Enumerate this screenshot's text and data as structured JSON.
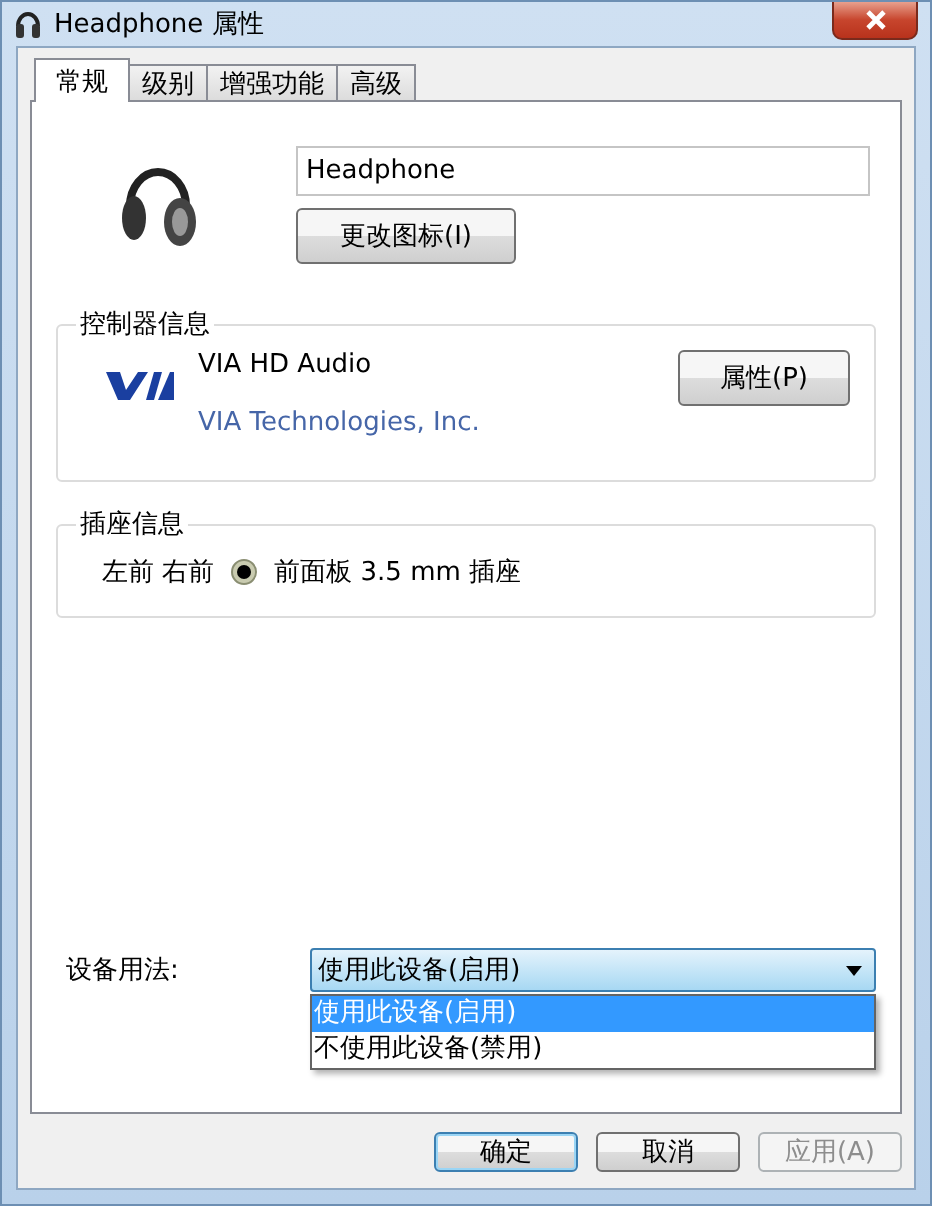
{
  "window": {
    "title": "Headphone 属性"
  },
  "tabs": [
    {
      "label": "常规",
      "selected": true
    },
    {
      "label": "级别",
      "selected": false
    },
    {
      "label": "增强功能",
      "selected": false
    },
    {
      "label": "高级",
      "selected": false
    }
  ],
  "device": {
    "name": "Headphone",
    "change_icon_button": "更改图标(I)"
  },
  "controller": {
    "title": "控制器信息",
    "name": "VIA HD Audio",
    "vendor": "VIA Technologies, Inc.",
    "properties_button": "属性(P)"
  },
  "jack": {
    "title": "插座信息",
    "position": "左前 右前",
    "description": "前面板 3.5 mm 插座"
  },
  "usage": {
    "label": "设备用法:",
    "value": "使用此设备(启用)",
    "expanded": true,
    "options": [
      {
        "label": "使用此设备(启用)",
        "selected": true
      },
      {
        "label": "不使用此设备(禁用)",
        "selected": false
      }
    ]
  },
  "buttons": [
    {
      "label": "确定",
      "default": true,
      "disabled": false
    },
    {
      "label": "取消",
      "default": false,
      "disabled": false
    },
    {
      "label": "应用(A)",
      "default": false,
      "disabled": true
    }
  ]
}
